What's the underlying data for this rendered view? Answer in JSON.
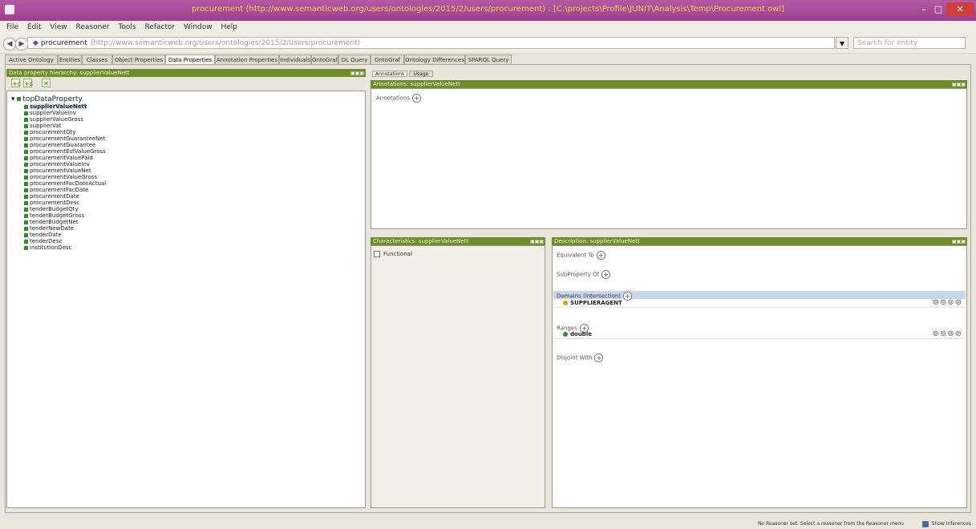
{
  "window": {
    "title": "procurement (http://www.semanticweb.org/users/ontologies/2015/2/users/procurement) : [C:\\projects\\Profile\\JUNIT\\Analysis\\Temp\\Procurement.owl]",
    "minimize": "–",
    "maximize": "□",
    "close": "✕"
  },
  "menu": [
    "File",
    "Edit",
    "View",
    "Reasoner",
    "Tools",
    "Refactor",
    "Window",
    "Help"
  ],
  "address": {
    "back": "◀",
    "forward": "▶",
    "ontology_name": "procurement",
    "ontology_iri": "(http://www.semanticweb.org/users/ontologies/2015/2/users/procurement)",
    "dropdown": "▼",
    "search_placeholder": "Search for entity"
  },
  "tabs": [
    "Active Ontology",
    "Entities",
    "Classes",
    "Object Properties",
    "Data Properties",
    "Annotation Properties",
    "Individuals",
    "OntoGraf",
    "DL Query",
    "OntoGraf",
    "Ontology Differences",
    "SPARQL Query"
  ],
  "active_tab": "Data Properties",
  "hierarchy": {
    "header": "Data property hierarchy: supplierValueNett",
    "root": "topDataProperty",
    "items": [
      "supplierValueNett",
      "supplierValueInv",
      "supplierValueGross",
      "supplierVat",
      "procurementQty",
      "procurementGuaranteeNet",
      "procurementGuarantee",
      "procurementEstValueGross",
      "procurementValuePaid",
      "procurementValueInv",
      "procurementValueNet",
      "procurementValueGross",
      "procurementFacDateActual",
      "procurementFacDate",
      "procurementDate",
      "procurementDesc",
      "tenderBudgetQty",
      "tenderBudgetGross",
      "tenderBudgetNet",
      "tenderNewDate",
      "tenderDate",
      "tenderDesc",
      "institutionDesc"
    ],
    "selected": "supplierValueNett",
    "toolbar": [
      "+c",
      "+s",
      "✕"
    ]
  },
  "annotations_panel": {
    "subtabs": [
      "Annotations",
      "Usage"
    ],
    "header": "Annotations: supplierValueNett",
    "annotations_label": "Annotations",
    "header_buttons": "▣▣▣"
  },
  "characteristics_panel": {
    "header": "Characteristics: supplierValueNett",
    "functional_label": "Functional",
    "header_buttons": "▣▣▣"
  },
  "description_panel": {
    "header": "Description: supplierValueNett",
    "equivalent_label": "Equivalent To",
    "subproperty_label": "SubProperty Of",
    "domains_label": "Domains (intersection)",
    "domain_value": "SUPPLIERAGENT",
    "ranges_label": "Ranges",
    "range_value": "double",
    "disjoint_label": "Disjoint With",
    "row_buttons": "⊚⊚⊚⊚",
    "header_buttons": "▣▣▣"
  },
  "status": {
    "message": "No Reasoner set. Select a reasoner from the Reasoner menu",
    "show_inferences": "Show Inferences"
  },
  "colors": {
    "titlebar": "#a84b98",
    "header_green": "#6e8c2a",
    "bullet_green": "#2f8a2a",
    "highlight_blue": "#c8d6ea"
  }
}
